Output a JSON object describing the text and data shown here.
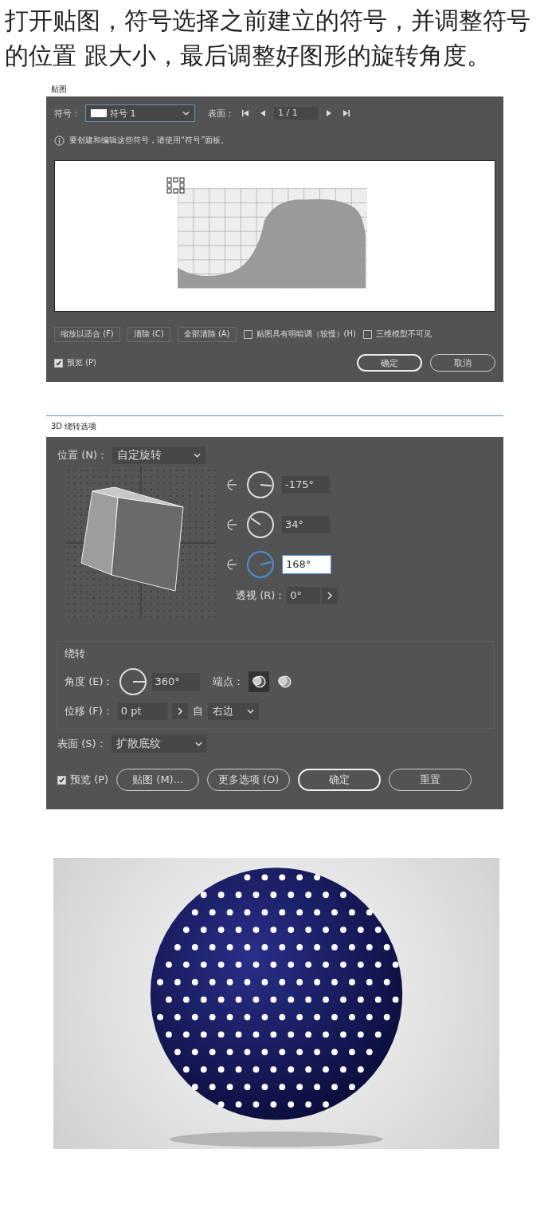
{
  "intro": "打开贴图，符号选择之前建立的符号，并调整符号的位置 跟大小，最后调整好图形的旋转角度。",
  "map_dialog": {
    "title": "贴图",
    "symbol_label": "符号：",
    "symbol_value": "符号 1",
    "surface_label": "表面：",
    "page_value": "1 / 1",
    "info": "要创建和编辑这些符号，请使用“符号”面板。",
    "buttons": [
      "缩放以适合 (F)",
      "清除 (C)",
      "全部清除 (A)"
    ],
    "checkboxes": [
      {
        "label": "贴图具有明暗调（较慢）(H)",
        "checked": false
      },
      {
        "label": "三维模型不可见",
        "checked": false
      }
    ],
    "preview": {
      "label": "预览 (P)",
      "checked": true
    },
    "actions": [
      {
        "label": "确定",
        "primary": true
      },
      {
        "label": "取消",
        "primary": false
      }
    ]
  },
  "rotate_dialog": {
    "title": "3D 绕转选项",
    "position_label": "位置 (N)：",
    "position_value": "自定旋转",
    "rotations": [
      {
        "value": "-175°",
        "selected": false
      },
      {
        "value": "34°",
        "selected": false
      },
      {
        "value": "168°",
        "selected": true
      }
    ],
    "perspective_label": "透视 (R)：",
    "perspective_value": "0°",
    "revolve_title": "绕转",
    "angle_label": "角度 (E)：",
    "angle_value": "360°",
    "cap_label": "端点：",
    "caps": [
      {
        "selected": true
      },
      {
        "selected": false
      }
    ],
    "offset_label": "位移 (F)：",
    "offset_value": "0 pt",
    "from_label": "自",
    "from_value": "右边",
    "surface_label": "表面 (S)：",
    "surface_value": "扩散底纹",
    "preview": {
      "label": "预览 (P)",
      "checked": true
    },
    "actions": [
      {
        "label": "贴图 (M)...",
        "primary": false
      },
      {
        "label": "更多选项 (O)",
        "primary": false
      },
      {
        "label": "确定",
        "primary": true
      },
      {
        "label": "重置",
        "primary": false
      }
    ]
  }
}
